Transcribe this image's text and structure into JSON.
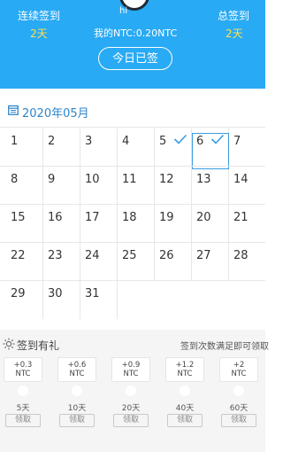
{
  "header": {
    "consecutive_label": "连续签到",
    "consecutive_value": "2天",
    "total_label": "总签到",
    "total_value": "2天",
    "username": "hi",
    "ntc_balance": "我的NTC:0.20NTC",
    "checkin_button": "今日已签"
  },
  "calendar": {
    "month_label": "2020年05月",
    "days": [
      "1",
      "2",
      "3",
      "4",
      "5",
      "6",
      "7",
      "8",
      "9",
      "10",
      "11",
      "12",
      "13",
      "14",
      "15",
      "16",
      "17",
      "18",
      "19",
      "20",
      "21",
      "22",
      "23",
      "24",
      "25",
      "26",
      "27",
      "28",
      "29",
      "30",
      "31"
    ],
    "checked_days": [
      "5",
      "6"
    ],
    "today": "6"
  },
  "gift": {
    "title": "签到有礼",
    "note": "签到次数满足即可领取",
    "rewards": [
      {
        "amount": "+0.3",
        "unit": "NTC",
        "days": "5天",
        "action": "领取"
      },
      {
        "amount": "+0.6",
        "unit": "NTC",
        "days": "10天",
        "action": "领取"
      },
      {
        "amount": "+0.9",
        "unit": "NTC",
        "days": "20天",
        "action": "领取"
      },
      {
        "amount": "+1.2",
        "unit": "NTC",
        "days": "40天",
        "action": "领取"
      },
      {
        "amount": "+2",
        "unit": "NTC",
        "days": "60天",
        "action": "领取"
      }
    ]
  },
  "colors": {
    "header_bg": "#29aaf4",
    "accent_yellow": "#ffe14d",
    "month_blue": "#2d86cc",
    "check_blue": "#3a9de0"
  }
}
